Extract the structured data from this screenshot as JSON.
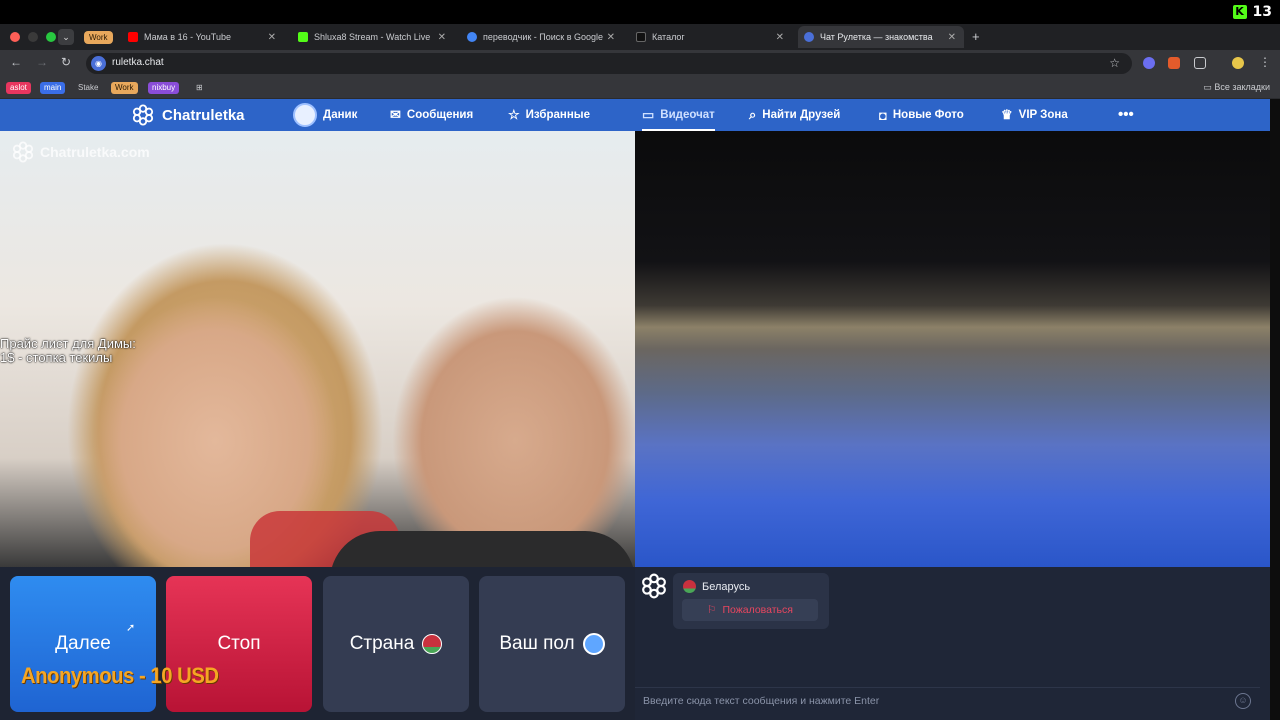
{
  "system": {
    "kick_label": "13",
    "kick_logo": "K"
  },
  "browser": {
    "tab_group": "Work",
    "tabs": [
      {
        "label": "Мама в 16 - YouTube",
        "favicon_color": "#ff0000"
      },
      {
        "label": "Shluxa8 Stream - Watch Live",
        "favicon_color": "#53fc18"
      },
      {
        "label": "переводчик - Поиск в Google",
        "favicon_color": "#4285f4"
      },
      {
        "label": "Каталог",
        "favicon_color": "#111111"
      },
      {
        "label": "Чат Рулетка — знакомства",
        "favicon_color": "#4a6fd8"
      }
    ],
    "url": "ruletka.chat",
    "bookmarks": [
      {
        "label": "aslot",
        "color": "#e8365f"
      },
      {
        "label": "main",
        "color": "#3a6ee8"
      },
      {
        "label": "Stake",
        "color": "transparent"
      },
      {
        "label": "Work",
        "color": "#e8a85c"
      },
      {
        "label": "nixbuy",
        "color": "#8a4dd8"
      }
    ],
    "all_bookmarks": "Все закладки"
  },
  "site": {
    "brand": "Chatruletka",
    "nav": {
      "user": "Даник",
      "messages": "Сообщения",
      "favorites": "Избранные",
      "videochat": "Видеочат",
      "find_friends": "Найти Друзей",
      "new_photos": "Новые Фото",
      "vip": "VIP Зона",
      "more": "•••"
    }
  },
  "video": {
    "watermark": "Chatruletka.com",
    "overlay_line1": "Прайс лист для Димы:",
    "overlay_line2": "1$ - стопка текилы"
  },
  "controls": {
    "next": "Далее",
    "stop": "Стоп",
    "country": "Страна",
    "gender": "Ваш пол",
    "donation": "Anonymous - 10 USD"
  },
  "chat": {
    "country": "Беларусь",
    "report": "Пожаловаться",
    "placeholder": "Введите сюда текст сообщения и нажмите Enter"
  }
}
